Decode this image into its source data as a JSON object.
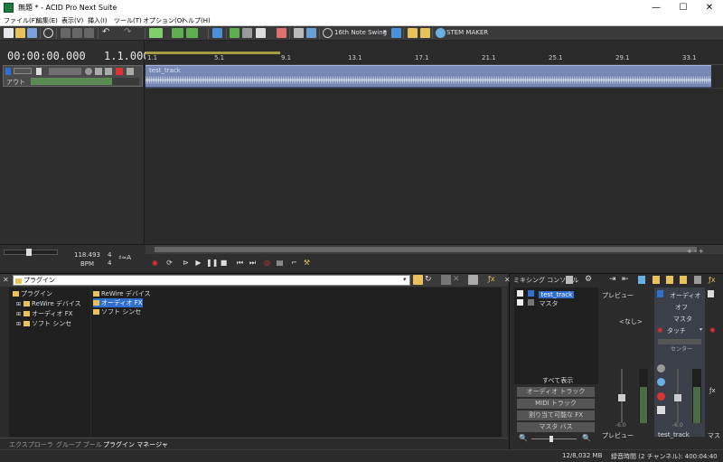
{
  "window": {
    "title": "無題 * - ACID Pro Next Suite",
    "minimize": "—",
    "maximize": "☐",
    "close": "✕"
  },
  "menu": [
    "ファイル(F)",
    "編集(E)",
    "表示(V)",
    "挿入(I)",
    "ツール(T)",
    "オプション(O)",
    "ヘルプ(H)"
  ],
  "toolbar": {
    "swing": "16th Note Swing",
    "stem_maker": "STEM MAKER"
  },
  "timeline": {
    "time": "00:00:00.000",
    "beat": "1.1.000",
    "ruler": [
      "1.1",
      "5.1",
      "9.1",
      "13.1",
      "17.1",
      "21.1",
      "25.1",
      "29.1",
      "33.1"
    ],
    "track_label": "アウト",
    "clip_name": "test_track"
  },
  "transport": {
    "bpm": "118.493",
    "bpm_label": "BPM",
    "sig_top": "4",
    "sig_bottom": "4"
  },
  "explorer": {
    "address": "プラグイン",
    "tree": [
      {
        "label": "プラグイン",
        "level": 0
      },
      {
        "label": "ReWire デバイス",
        "level": 1
      },
      {
        "label": "オーディオ FX",
        "level": 1
      },
      {
        "label": "ソフト シンセ",
        "level": 1
      }
    ],
    "list": [
      "ReWire デバイス",
      "オーディオ FX",
      "ソフト シンセ"
    ],
    "tabs": [
      "エクスプローラ",
      "グループ プール",
      "プラグイン マネージャ"
    ]
  },
  "mixer": {
    "title": "ミキシング コンソール",
    "tracks": [
      "test_track",
      "マスタ"
    ],
    "buttons": [
      "すべて表示",
      "オーディオ トラック",
      "MIDI トラック",
      "割り当て可能な FX",
      "マスタ バス"
    ],
    "preview_label": "プレビュー",
    "none_label": "<なし>",
    "track_strip": {
      "off": "オフ",
      "master": "マスタ",
      "touch": "タッチ",
      "center": "センター",
      "db": "-6.0",
      "name": "test_track",
      "audio_label": "オーディオ"
    },
    "preview_db": "-6.0",
    "master_label": "マス"
  },
  "status": {
    "memory": "12/8,032 MB",
    "record": "録音時間 (2 チャンネル): 400:04:40"
  }
}
